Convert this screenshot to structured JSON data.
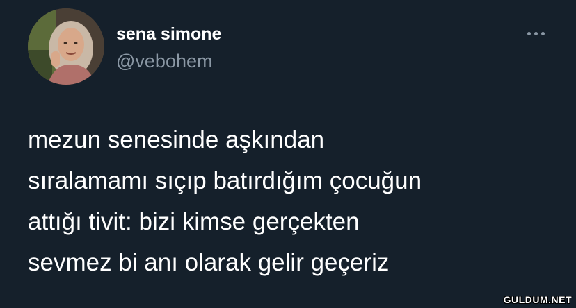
{
  "user": {
    "display_name": "sena simone",
    "handle": "@vebohem"
  },
  "more_icon": "more-horizontal-icon",
  "tweet": {
    "lines": [
      "mezun senesinde aşkından",
      "sıralamamı sıçıp batırdığım çocuğun",
      "attığı tivit: bizi kimse gerçekten",
      "sevmez bi anı olarak gelir geçeriz"
    ]
  },
  "watermark": "GULDUM.NET",
  "colors": {
    "background": "#15202b",
    "primary_text": "#ffffff",
    "secondary_text": "#8b98a5"
  }
}
